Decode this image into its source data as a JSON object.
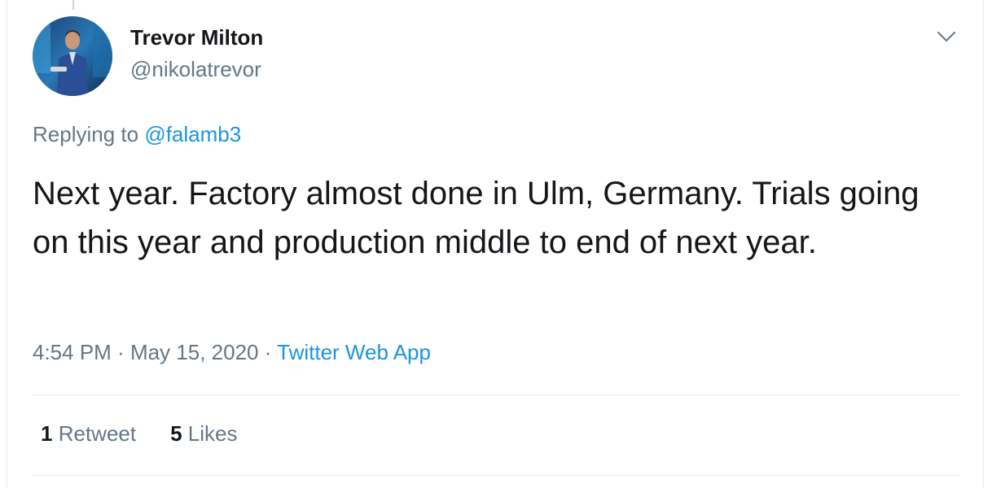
{
  "author": {
    "display_name": "Trevor Milton",
    "handle": "@nikolatrevor"
  },
  "reply": {
    "prefix": "Replying to ",
    "mention": "@falamb3"
  },
  "tweet": {
    "text": "Next year. Factory almost done in Ulm, Germany. Trials going on this year and production middle to end of next year."
  },
  "meta": {
    "time": "4:54 PM",
    "separator1": " · ",
    "date": "May 15, 2020",
    "separator2": " · ",
    "source": "Twitter Web App"
  },
  "stats": {
    "retweets_count": "1",
    "retweets_label": "Retweet",
    "likes_count": "5",
    "likes_label": "Likes"
  },
  "icons": {
    "caret": "chevron-down-icon",
    "avatar": "avatar"
  },
  "colors": {
    "link": "#1b95e0",
    "secondary_text": "#657786",
    "primary_text": "#14171a",
    "divider": "#e6ecf0"
  }
}
